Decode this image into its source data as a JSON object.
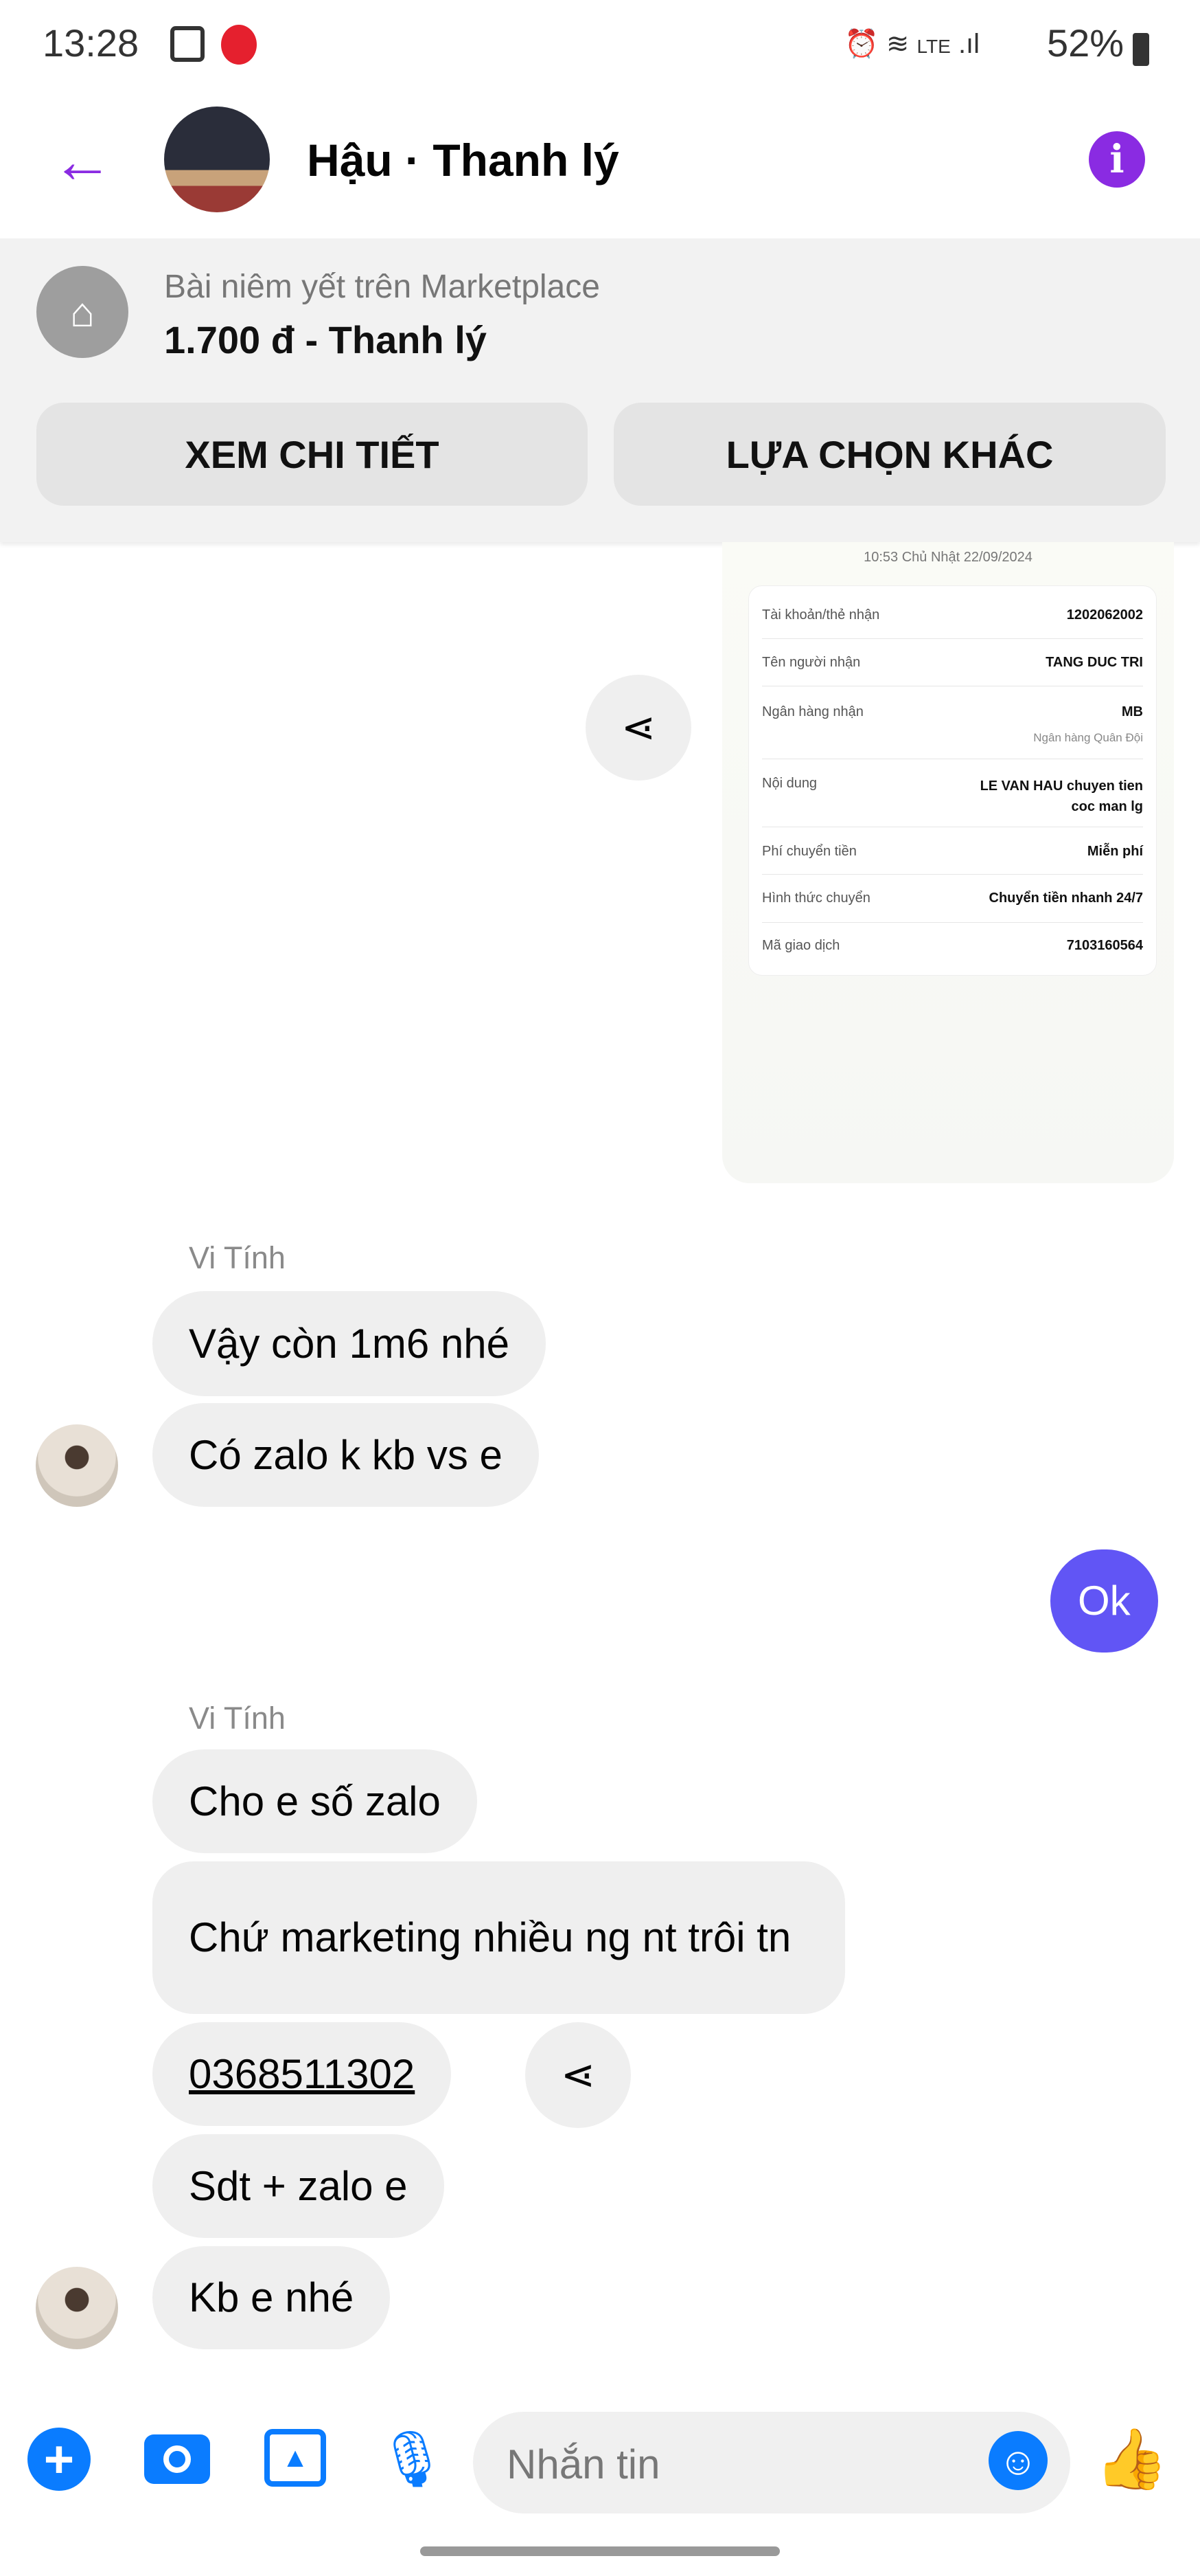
{
  "status_bar": {
    "time": "13:28",
    "battery": "52%",
    "network": "LTE"
  },
  "header": {
    "title": "Hậu · Thanh lý"
  },
  "listing": {
    "subtitle": "Bài niêm yết trên Marketplace",
    "title": "1.700 đ - Thanh lý",
    "view_details": "XEM CHI TIẾT",
    "other_options": "LỰA CHỌN KHÁC"
  },
  "receipt": {
    "datetime": "10:53 Chủ Nhật 22/09/2024",
    "rows": [
      {
        "label": "Tài khoản/thẻ nhận",
        "value": "1202062002"
      },
      {
        "label": "Tên người nhận",
        "value": "TANG DUC TRI"
      },
      {
        "label": "Ngân hàng nhận",
        "value": "MB",
        "sub": "Ngân hàng Quân Đội"
      },
      {
        "label": "Nội dung",
        "value": "LE VAN HAU chuyen tien coc man lg"
      },
      {
        "label": "Phí chuyển tiền",
        "value": "Miễn phí"
      },
      {
        "label": "Hình thức chuyển",
        "value": "Chuyển tiền nhanh 24/7"
      },
      {
        "label": "Mã giao dịch",
        "value": "7103160564"
      }
    ]
  },
  "messages": {
    "sender1": "Vi Tính",
    "m1": "Vậy còn 1m6 nhé",
    "m2": "Có zalo k kb vs e",
    "me1": "Ok",
    "sender2": "Vi Tính",
    "m3": "Cho e số zalo",
    "m4": "Chứ marketing nhiều ng nt trôi tn",
    "m5": "0368511302",
    "m6": "Sdt + zalo e",
    "m7": "Kb e nhé"
  },
  "composer": {
    "placeholder": "Nhắn tin"
  },
  "colors": {
    "accent": "#8a2be2",
    "my_bubble": "#6155f5",
    "icon_blue": "#0a7cff"
  }
}
